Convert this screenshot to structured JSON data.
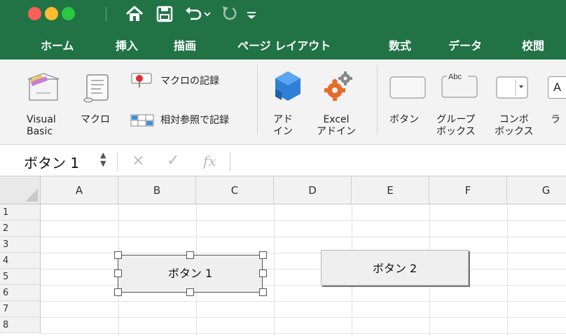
{
  "titlebar": {
    "icons": [
      "home-icon",
      "save-icon",
      "undo-icon",
      "undo-dropdown-icon",
      "redo-icon",
      "customize-toolbar-icon"
    ]
  },
  "tabs": [
    "ホーム",
    "挿入",
    "描画",
    "ページ レイアウト",
    "数式",
    "データ",
    "校閲"
  ],
  "ribbon": {
    "visual_basic": "Visual Basic",
    "visual_basic_l1": "Visual",
    "visual_basic_l2": "Basic",
    "macro": "マクロ",
    "record_macro": "マクロの記録",
    "relative_ref": "相対参照で記録",
    "addins_l1": "アド",
    "addins_l2": "イン",
    "excel_addins_l1": "Excel",
    "excel_addins_l2": "アドイン",
    "button": "ボタン",
    "groupbox_l1": "グループ",
    "groupbox_l2": "ボックス",
    "combobox_l1": "コンボ",
    "combobox_l2": "ボックス",
    "label_partial": "ラ",
    "groupbox_icon_text": "Abc",
    "text_partial": "A"
  },
  "formula_bar": {
    "name_box": "ボタン 1",
    "cancel_symbol": "×",
    "enter_symbol": "✓",
    "fx_symbol": "fx",
    "formula_value": ""
  },
  "sheet": {
    "columns": [
      "A",
      "B",
      "C",
      "D",
      "E",
      "F",
      "G"
    ],
    "rows": [
      "1",
      "2",
      "3",
      "4",
      "5",
      "6",
      "7",
      "8"
    ]
  },
  "buttons": {
    "button1": "ボタン 1",
    "button2": "ボタン 2"
  },
  "colors": {
    "accent": "#217346",
    "ribbon_bg": "#f3f3f3"
  }
}
